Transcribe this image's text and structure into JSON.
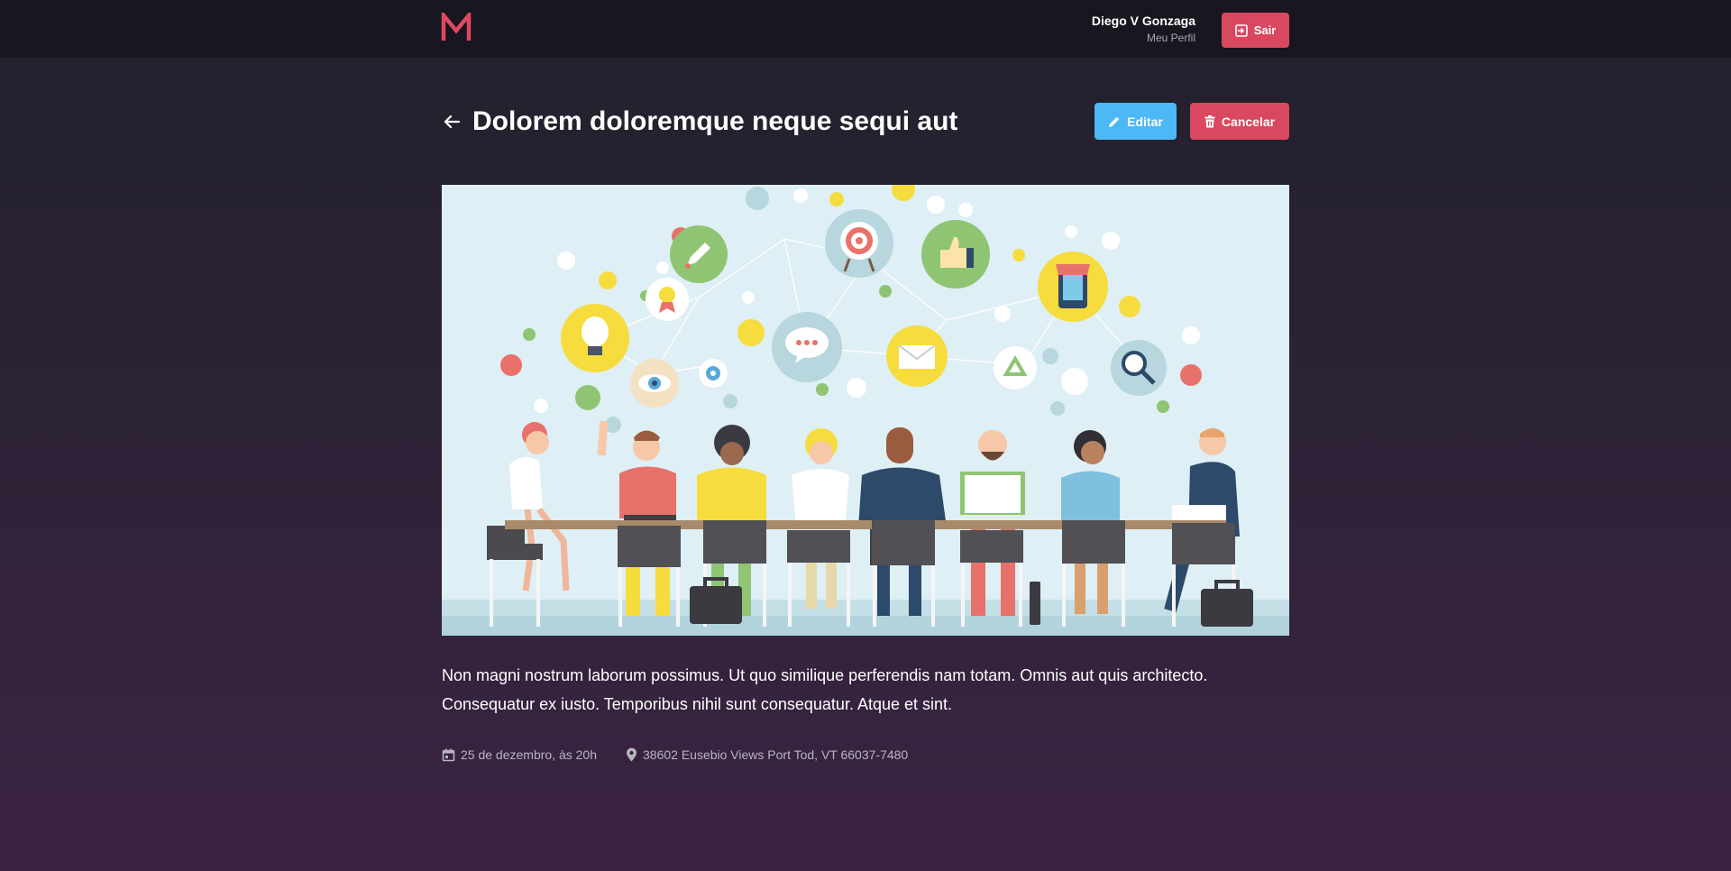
{
  "header": {
    "user_name": "Diego V Gonzaga",
    "profile_link": "Meu Perfil",
    "exit_label": "Sair"
  },
  "meetup": {
    "title": "Dolorem doloremque neque sequi aut",
    "edit_label": "Editar",
    "cancel_label": "Cancelar",
    "description": "Non magni nostrum laborum possimus. Ut quo similique perferendis nam totam. Omnis aut quis architecto. Consequatur ex iusto. Temporibus nihil sunt consequatur. Atque et sint.",
    "date": "25 de dezembro, às 20h",
    "location": "38602 Eusebio Views Port Tod, VT 66037-7480"
  },
  "icons": {
    "logo": "m-logo-icon",
    "exit": "exit-icon",
    "back": "arrow-left-icon",
    "edit": "pencil-icon",
    "cancel": "trash-icon",
    "date": "calendar-icon",
    "location": "pin-icon"
  },
  "colors": {
    "accent": "#d9485f",
    "edit_button": "#4cb8f5",
    "header_bg": "#18161f",
    "meta_text": "#b8b5c0"
  }
}
